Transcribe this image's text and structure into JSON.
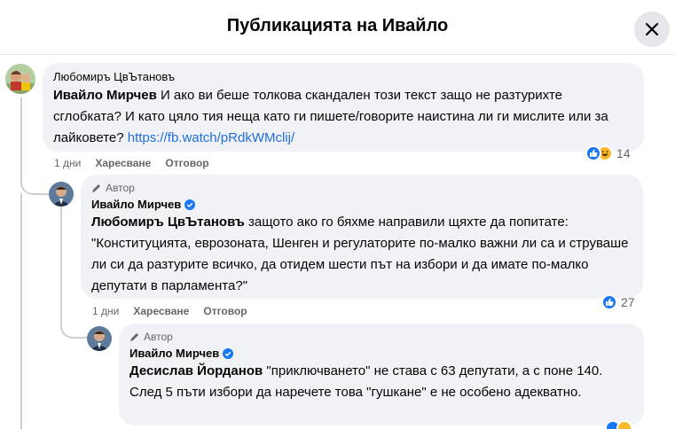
{
  "header": {
    "title": "Публикацията на Ивайло"
  },
  "comments": [
    {
      "author": "Любомиръ ЦвЪтановъ",
      "mention": "Ивайло Мирчев",
      "text": " И ако ви беше толкова скандален този текст защо не разтурихте сглобката? И като цяло тия неща като ги пишете/говорите наистина ли ги мислите или за лайковете? ",
      "link": "https://fb.watch/pRdkWMclij/",
      "time": "1 дни",
      "like_label": "Харесване",
      "reply_label": "Отговор",
      "reaction_count": "14"
    },
    {
      "badge": "Автор",
      "author": "Ивайло Мирчев",
      "mention": "Любомиръ ЦвЪтановъ",
      "text": " защото ако го бяхме направили щяхте да попитате: \"Конституцията, еврозоната, Шенген и регулаторите по-малко важни ли са и струваше ли си да разтурите всичко, да отидем шести път на избори и да имате по-малко депутати в парламента?\"",
      "time": "1 дни",
      "like_label": "Харесване",
      "reply_label": "Отговор",
      "reaction_count": "27"
    },
    {
      "badge": "Автор",
      "author": "Ивайло Мирчев",
      "mention": "Десислав Йорданов",
      "text": " \"приключването\" не става с 63 депутати, а с поне 140. След 5 пъти избори да наречете това \"гушкане\" е не особено адекватно."
    }
  ],
  "icons": {
    "close": "close-icon",
    "author_badge": "pencil-icon",
    "verified": "verified-badge-icon",
    "like": "like-reaction-icon",
    "haha": "haha-reaction-icon"
  },
  "colors": {
    "link": "#216fdb",
    "bubble": "#f0f2f5",
    "like_blue": "#1877f2",
    "haha_yellow": "#f7b928",
    "muted": "#65676b"
  }
}
